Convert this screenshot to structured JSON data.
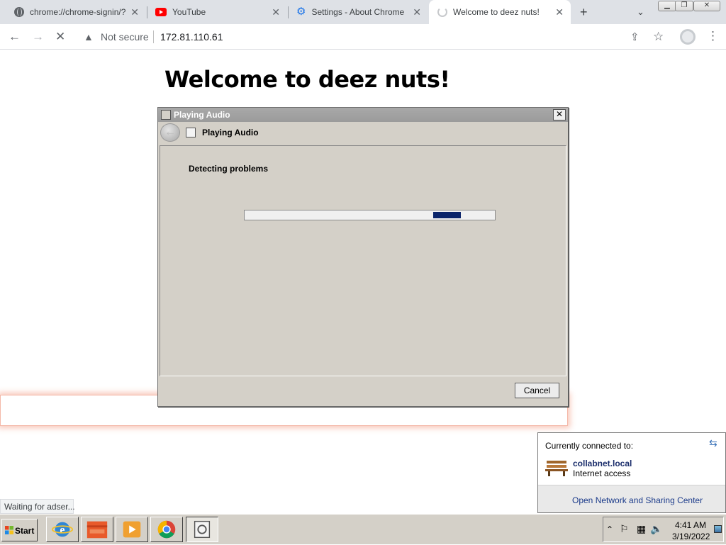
{
  "tabs": [
    {
      "title": "chrome://chrome-signin/?ac",
      "favicon": "globe-icon",
      "active": false
    },
    {
      "title": "YouTube",
      "favicon": "youtube-icon",
      "active": false
    },
    {
      "title": "Settings - About Chrome",
      "favicon": "gear-icon",
      "active": false
    },
    {
      "title": "Welcome to deez nuts!",
      "favicon": "loading-spinner-icon",
      "active": true
    }
  ],
  "toolbar": {
    "security_label": "Not secure",
    "url": "172.81.110.61"
  },
  "page": {
    "heading": "Welcome to deez nuts!"
  },
  "dialog": {
    "title": "Playing Audio",
    "header": "Playing Audio",
    "status": "Detecting problems",
    "progress_indeterminate": true,
    "cancel_label": "Cancel"
  },
  "status_bubble": "Waiting for adser...",
  "network_popup": {
    "header": "Currently connected to:",
    "network_name": "collabnet.local",
    "access": "Internet access",
    "link": "Open Network and Sharing Center"
  },
  "taskbar": {
    "start_label": "Start",
    "apps": [
      "internet-explorer-icon",
      "file-explorer-icon",
      "media-player-icon",
      "chrome-icon",
      "troubleshooter-icon"
    ],
    "time": "4:41 AM",
    "date": "3/19/2022"
  },
  "colors": {
    "dialog_bg": "#d4d0c8",
    "progress_fill": "#0a246a",
    "chrome_tabstrip": "#dee1e6"
  }
}
